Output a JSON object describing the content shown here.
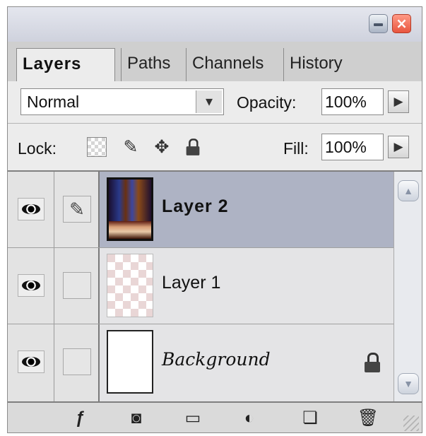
{
  "window": {
    "close_label": "×"
  },
  "tabs": [
    {
      "label": "Layers",
      "active": true
    },
    {
      "label": "Paths"
    },
    {
      "label": "Channels"
    },
    {
      "label": "History"
    }
  ],
  "blend": {
    "mode": "Normal",
    "opacity_label": "Opacity:",
    "opacity_value": "100%"
  },
  "lock": {
    "label": "Lock:",
    "fill_label": "Fill:",
    "fill_value": "100%"
  },
  "layers": [
    {
      "name": "Layer 2",
      "selected": true,
      "visible": true,
      "thumbnail": "photo"
    },
    {
      "name": "Layer 1",
      "selected": false,
      "visible": true,
      "thumbnail": "transparent"
    },
    {
      "name": "Background",
      "selected": false,
      "visible": true,
      "thumbnail": "white",
      "locked": true
    }
  ],
  "icons": {
    "tab_menu": "►",
    "dropdown_arrow": "▾",
    "step_arrow": "▶",
    "move": "✥",
    "brush": "✎",
    "scroll_up": "▲",
    "scroll_down": "▼",
    "layer_style": "ƒ",
    "mask": "◙",
    "new_group": "▭",
    "adjustment": "◐",
    "new_layer": "❏",
    "trash": "🗑"
  },
  "colors": {
    "selected_row": "#aeb3c4",
    "close_button": "#e8553e"
  }
}
